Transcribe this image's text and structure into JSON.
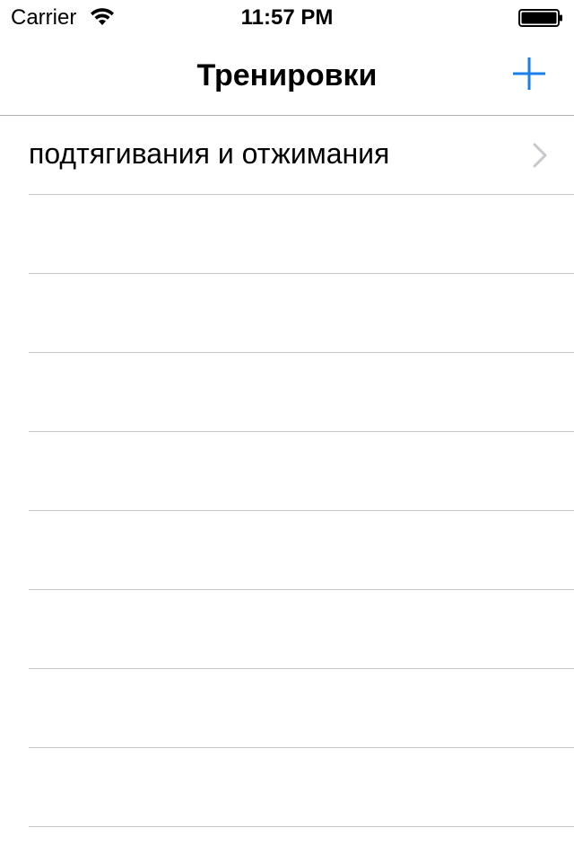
{
  "status_bar": {
    "carrier": "Carrier",
    "time": "11:57 PM",
    "wifi_icon": "wifi-icon",
    "battery_icon": "battery-icon"
  },
  "nav_bar": {
    "title": "Тренировки",
    "add_icon": "plus-icon",
    "accent_color": "#1a7fe8"
  },
  "table": {
    "rows": [
      {
        "label": "подтягивания и отжимания",
        "disclosure": true
      },
      {
        "label": "",
        "disclosure": false
      },
      {
        "label": "",
        "disclosure": false
      },
      {
        "label": "",
        "disclosure": false
      },
      {
        "label": "",
        "disclosure": false
      },
      {
        "label": "",
        "disclosure": false
      },
      {
        "label": "",
        "disclosure": false
      },
      {
        "label": "",
        "disclosure": false
      },
      {
        "label": "",
        "disclosure": false
      }
    ],
    "separator_color": "#c8c7cc",
    "chevron_color": "#c7c7cc"
  }
}
